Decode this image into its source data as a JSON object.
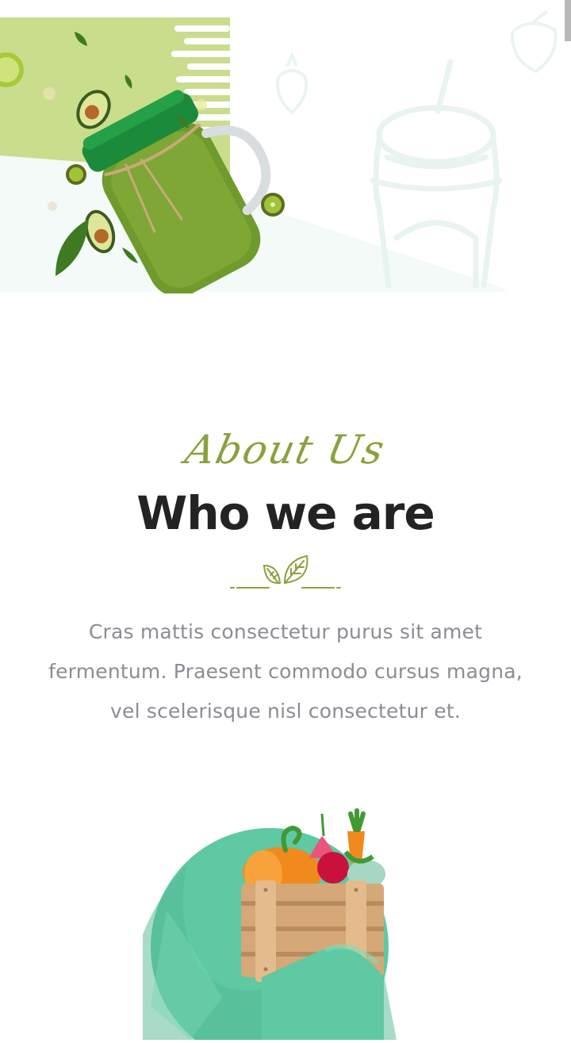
{
  "hero": {
    "image_name": "smoothie-jar-with-avocado-kiwi-lime",
    "colors": {
      "green_band": "#c9dd8c",
      "pale_mint": "#f3faf7",
      "jar": "#6f9a2c",
      "lid": "#1b8a3a"
    }
  },
  "about": {
    "script_label": "About Us",
    "heading": "Who we are",
    "divider_icon": "leaf-icon",
    "paragraph": "Cras mattis consectetur purus sit amet fermentum. Praesent commodo cursus magna, vel scelerisque nisl consectetur et."
  },
  "feature_image": {
    "image_name": "vegetable-crate-on-green-circle",
    "colors": {
      "circle": "#5ec9a3",
      "crate": "#d6a877",
      "pumpkin": "#f08a1c"
    }
  },
  "theme": {
    "accent": "#8aa23c",
    "heading_color": "#232323",
    "text_color": "#8c8c94"
  }
}
